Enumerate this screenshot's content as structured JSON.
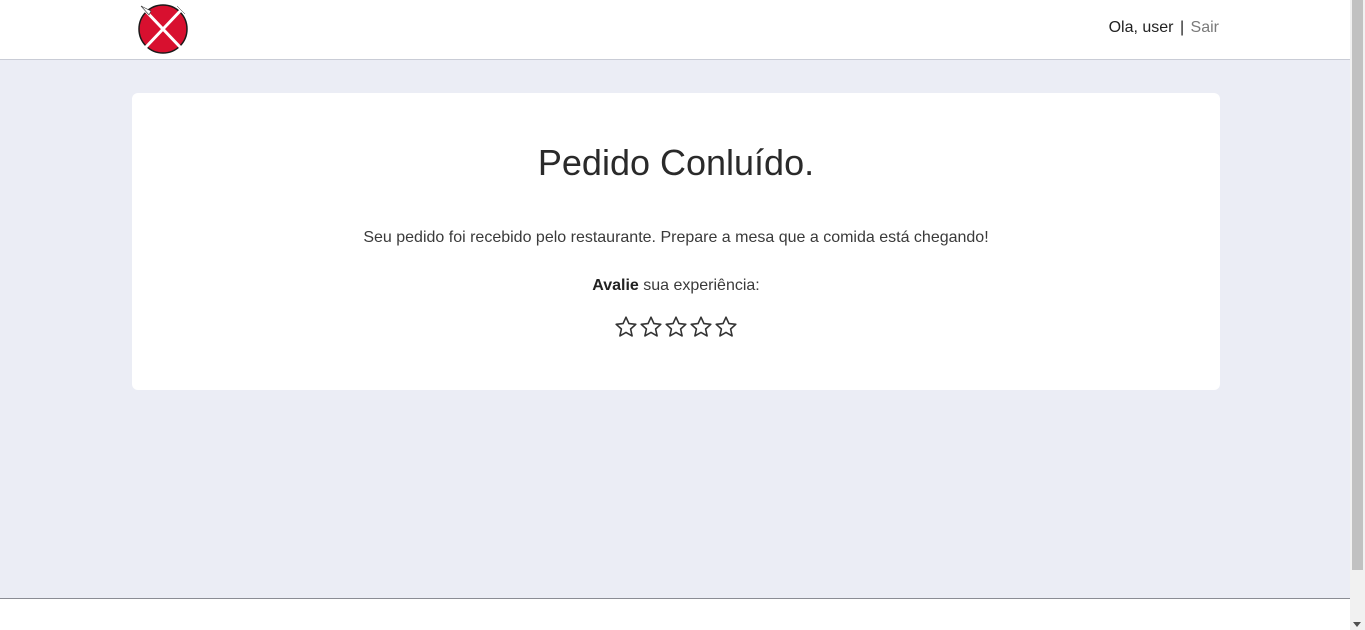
{
  "header": {
    "logo_icon": "plate-knife-fork-icon",
    "greeting": "Ola, user",
    "separator": "|",
    "logout_label": "Sair"
  },
  "card": {
    "title": "Pedido Conluído.",
    "message": "Seu pedido foi recebido pelo restaurante. Prepare a mesa que a comida está chegando!",
    "rate_bold": "Avalie",
    "rate_rest": " sua experiência:",
    "rating": {
      "max": 5,
      "value": 0,
      "icon": "star-outline-icon"
    }
  },
  "colors": {
    "background": "#ebedf5",
    "logo_red": "#d8102f",
    "link_gray": "#7a7a7a"
  }
}
